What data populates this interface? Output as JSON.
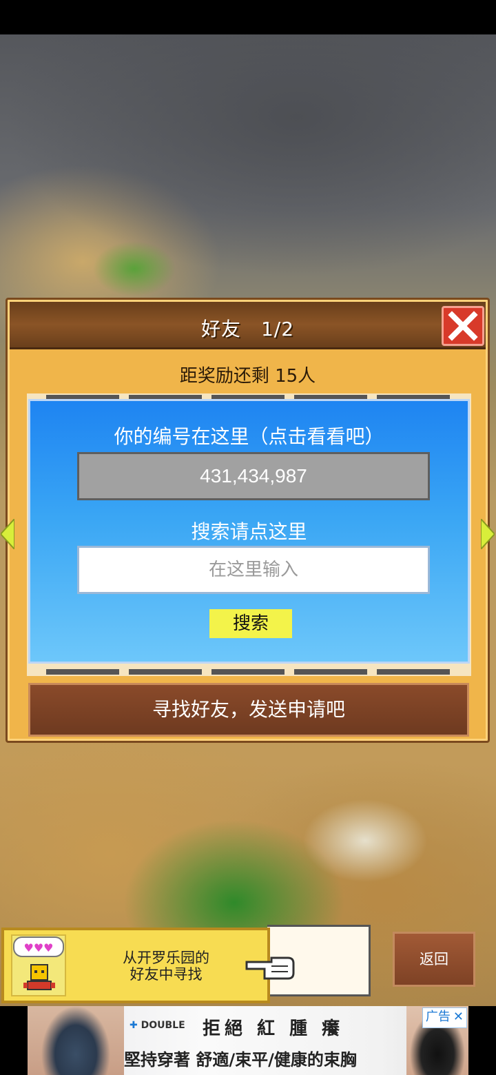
{
  "dialog": {
    "title": "好友　1/2",
    "reward_text": "距奖励还剩 15人",
    "id_label": "你的编号在这里（点击看看吧）",
    "id_value": "431,434,987",
    "search_label": "搜索请点这里",
    "search_placeholder": "在这里输入",
    "search_button": "搜索",
    "find_friends_button": "寻找好友，发送申请吧"
  },
  "bottom": {
    "cairo_text": "从开罗乐园的\n好友中寻找",
    "back_button": "返回"
  },
  "ad": {
    "brand": "DOUBLE",
    "headline": "拒絕 紅 腫 癢",
    "subline": "堅持穿著 舒適/束平/健康的束胸",
    "tag": "广告"
  },
  "colors": {
    "panel_blue": "#1e84f2",
    "dialog_gold": "#f0b54a",
    "search_yellow": "#f3f34a",
    "close_red": "#d83a2a"
  },
  "icons": [
    "close-icon",
    "left-arrow-icon",
    "right-arrow-icon",
    "hearts-icon",
    "robot-icon",
    "pointing-hand-icon",
    "ad-close-icon"
  ]
}
